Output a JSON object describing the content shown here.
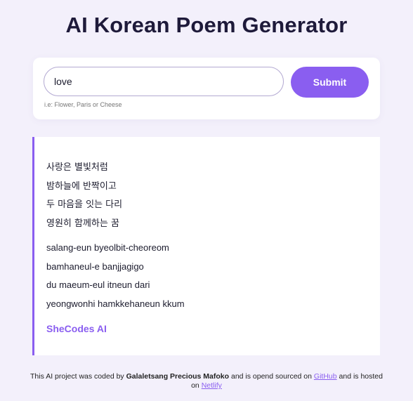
{
  "header": {
    "title": "AI Korean Poem Generator"
  },
  "form": {
    "input_value": "love",
    "hint": "i.e: Flower, Paris or Cheese",
    "submit_label": "Submit"
  },
  "poem": {
    "korean_lines": [
      "사랑은 별빛처럼",
      "밤하늘에 반짝이고",
      "두 마음을 잇는 다리",
      "영원히 함께하는 꿈"
    ],
    "romanized_lines": [
      "salang-eun byeolbit-cheoreom",
      "bamhaneul-e banjjagigo",
      "du maeum-eul itneun dari",
      "yeongwonhi hamkkehaneun kkum"
    ],
    "signature": "SheCodes AI"
  },
  "footer": {
    "text_1": "This AI project was coded by ",
    "author": "Galaletsang Precious Mafoko",
    "text_2": " and is opend sourced on ",
    "github_label": "GitHub",
    "text_3": " and is hosted on ",
    "netlify_label": "Netlify"
  },
  "colors": {
    "accent": "#8a5ef0",
    "background": "#f3f0fb",
    "title": "#1e1a3a"
  }
}
